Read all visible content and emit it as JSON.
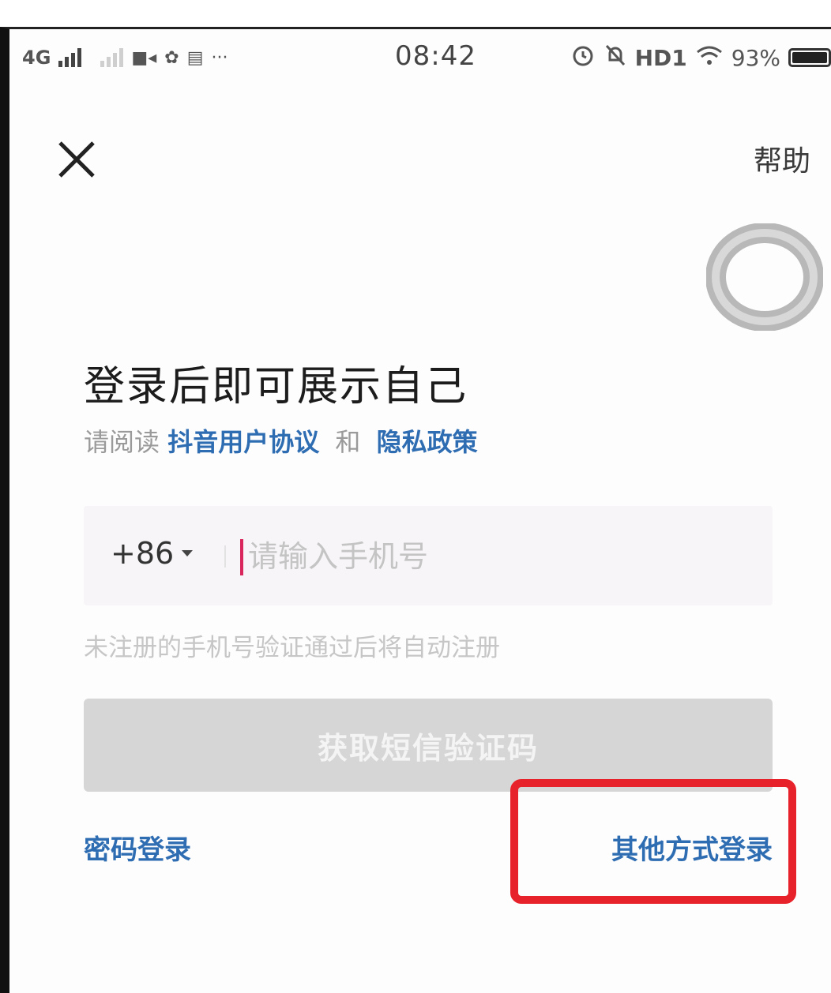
{
  "status_bar": {
    "network": "4G",
    "icons_left": [
      "signal-icon",
      "signal-weak-icon",
      "video-icon",
      "app-icon",
      "app-icon",
      "more-icon"
    ],
    "time": "08:42",
    "hd_label": "HD1",
    "battery_percent": "93%"
  },
  "header": {
    "close_icon": "close-icon",
    "help_label": "帮助"
  },
  "main": {
    "title": "登录后即可展示自己",
    "agreement": {
      "prefix": "请阅读",
      "user_agreement_link": "抖音用户协议",
      "connector": "和",
      "privacy_link": "隐私政策"
    },
    "phone": {
      "country_code": "+86",
      "placeholder": "请输入手机号"
    },
    "hint": "未注册的手机号验证通过后将自动注册",
    "sms_button_label": "获取短信验证码",
    "password_login_label": "密码登录",
    "other_login_label": "其他方式登录"
  },
  "colors": {
    "link": "#2f6db3",
    "button_disabled": "#d6d6d6",
    "cursor": "#d9265c",
    "highlight": "#e8222a"
  }
}
